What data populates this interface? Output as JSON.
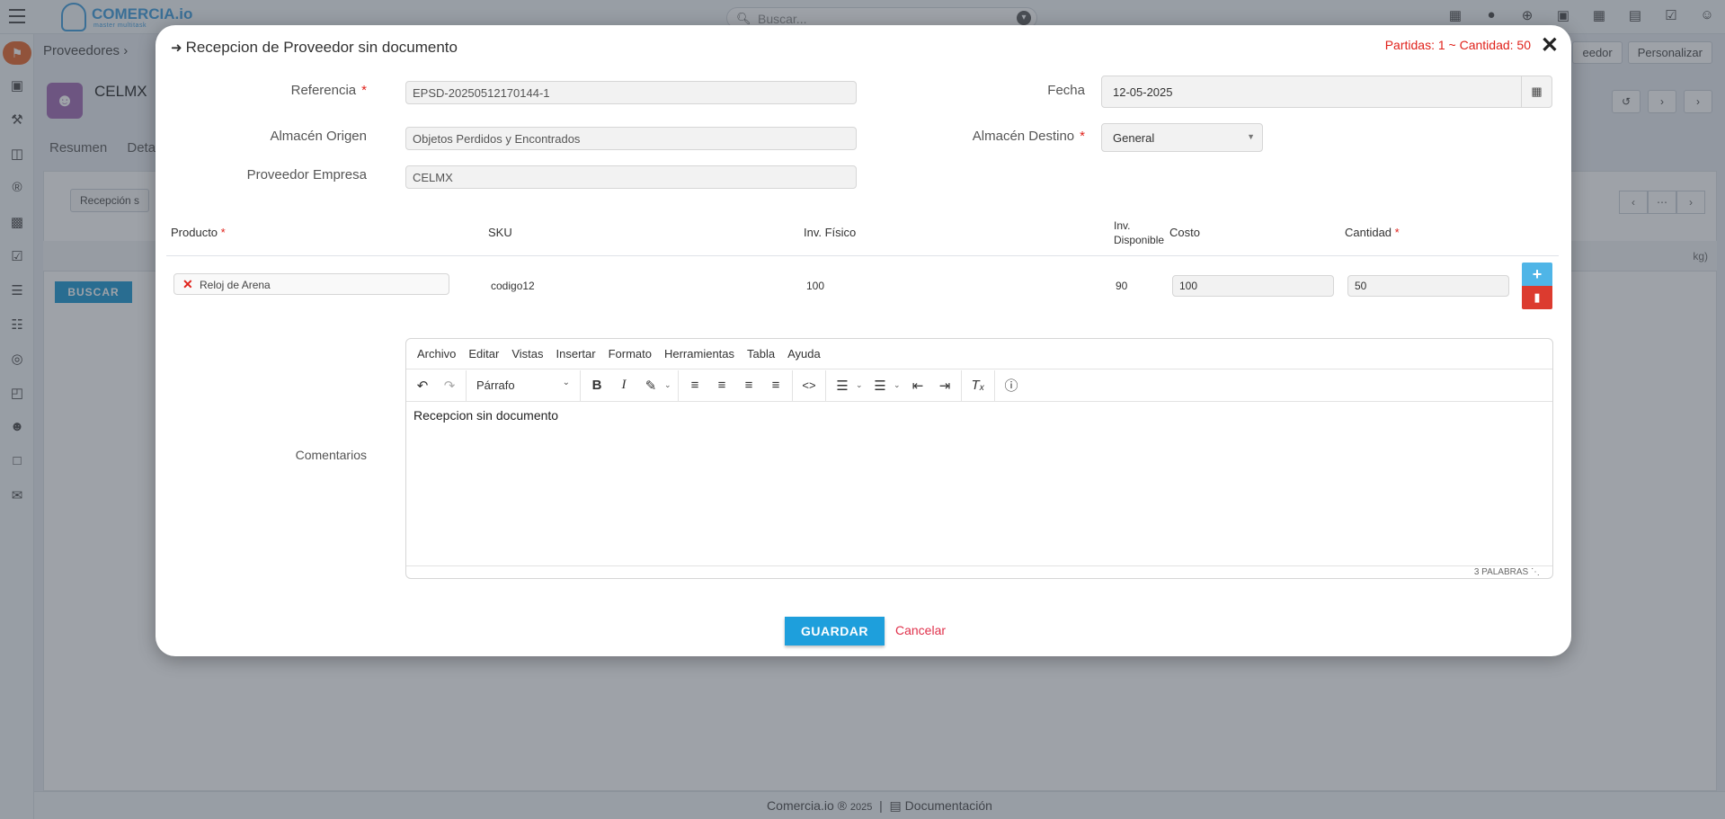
{
  "app": {
    "logo_name": "COMERCIA.io",
    "logo_tagline": "master multitask",
    "search_placeholder": "Buscar...",
    "breadcrumb": "Proveedores",
    "company_name": "CELMX",
    "tabs": [
      "Resumen",
      "Detal"
    ],
    "header_buttons": [
      "eedor",
      "Personalizar"
    ],
    "recepcion_button": "Recepción s",
    "buscar_label": "BUSCAR",
    "table_unit": "kg)",
    "footer_brand": "Comercia.io",
    "footer_year": "2025",
    "footer_docs": "Documentación"
  },
  "modal": {
    "title": "Recepcion de Proveedor sin documento",
    "summary": "Partidas: 1 ~ Cantidad: 50",
    "referencia_label": "Referencia",
    "referencia_value": "EPSD-20250512170144-1",
    "fecha_label": "Fecha",
    "fecha_value": "12-05-2025",
    "almacen_origen_label": "Almacén Origen",
    "almacen_origen_value": "Objetos Perdidos y Encontrados",
    "almacen_destino_label": "Almacén Destino",
    "almacen_destino_value": "General",
    "proveedor_label": "Proveedor Empresa",
    "proveedor_value": "CELMX",
    "columns": {
      "producto": "Producto",
      "sku": "SKU",
      "inv_fisico": "Inv. Físico",
      "inv_disponible_1": "Inv.",
      "inv_disponible_2": "Disponible",
      "costo": "Costo",
      "cantidad": "Cantidad"
    },
    "row": {
      "producto": "Reloj de Arena",
      "sku": "codigo12",
      "inv_fisico": "100",
      "inv_disponible": "90",
      "costo": "100",
      "cantidad": "50"
    },
    "comentarios_label": "Comentarios",
    "editor": {
      "menu": [
        "Archivo",
        "Editar",
        "Vistas",
        "Insertar",
        "Formato",
        "Herramientas",
        "Tabla",
        "Ayuda"
      ],
      "block_format": "Párrafo",
      "content": "Recepcion sin documento",
      "word_count": "3 PALABRAS"
    },
    "save_label": "GUARDAR",
    "cancel_label": "Cancelar"
  },
  "colors": {
    "accent_blue": "#1e9fdc",
    "danger_red": "#dc3b2f",
    "required_red": "#e0221b"
  }
}
